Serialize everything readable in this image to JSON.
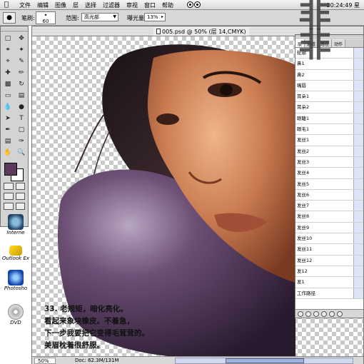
{
  "menubar": {
    "items": [
      "文件",
      "编辑",
      "图像",
      "层",
      "选择",
      "过滤器",
      "审视",
      "窗口",
      "帮助"
    ],
    "clock": "20:24:49 星"
  },
  "options": {
    "brush_label": "笔刷:",
    "brush_size": "60",
    "range_label": "范围:",
    "range_value": "高光部",
    "exposure_label": "曝光量:",
    "exposure_value": "13%"
  },
  "document": {
    "title": "005.psd @ 50% (层 14,CMYK)",
    "zoom": "50%",
    "doc_size": "Doc: 62.3M/131M"
  },
  "desktop_icons": [
    {
      "label": "Interne"
    },
    {
      "label": "Outlook Ex"
    },
    {
      "label": "Photosho"
    },
    {
      "label": "DVD"
    }
  ],
  "layers_panel": {
    "tabs": [
      "层",
      "通道",
      "路径",
      "动作"
    ],
    "rows": [
      "轮廓",
      "鼻1",
      "鼻2",
      "嘴唇",
      "耳朵1",
      "耳朵2",
      "眼睫1",
      "眼毛1",
      "发丝1",
      "发丝2",
      "发丝3",
      "发丝4",
      "发丝5",
      "发丝6",
      "发丝7",
      "发丝8",
      "发丝9",
      "发丝10",
      "发丝11",
      "发丝12",
      "发12",
      "发1",
      "工作路径"
    ]
  },
  "watermark": "非非",
  "caption": {
    "line1": "33. 老规矩，暗化亮化。",
    "line2": "看起来象块橡皮。不着急，",
    "line3": "下一步我要把它变得毛茸茸的。",
    "line4": "美眉枕着很舒服。"
  },
  "colors": {
    "foreground": "#5b3a5c",
    "pillow": "#5e4366",
    "skin": "#c27a52"
  }
}
